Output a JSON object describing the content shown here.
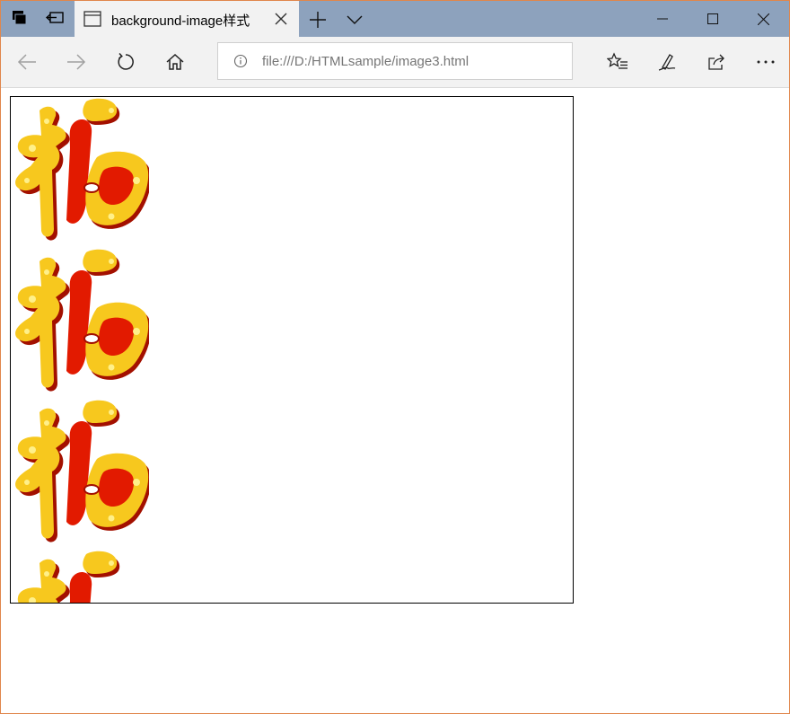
{
  "browser": {
    "tab": {
      "title": "background-image样式",
      "close_icon": "close-icon",
      "page_icon": "page-icon"
    },
    "new_tab_icon": "plus-icon",
    "tab_menu_icon": "chevron-down-icon",
    "window_controls": [
      "minimize-icon",
      "maximize-icon",
      "close-icon"
    ],
    "nav": {
      "back_icon": "arrow-left-icon",
      "forward_icon": "arrow-right-icon",
      "refresh_icon": "refresh-icon",
      "home_icon": "home-icon",
      "favorites_icon": "favorites-icon",
      "notes_icon": "pen-icon",
      "share_icon": "share-icon",
      "more_icon": "more-icon"
    },
    "address": {
      "url": "file:///D:/HTMLsample/image3.html",
      "info_icon": "info-icon"
    }
  },
  "page": {
    "box_border_color": "#000000",
    "background_image": {
      "glyph": "福",
      "repeat": "repeat-y",
      "colors": {
        "gold": "#f7c81e",
        "light": "#fff08a",
        "red": "#e21a00",
        "dark": "#a31000"
      }
    }
  }
}
